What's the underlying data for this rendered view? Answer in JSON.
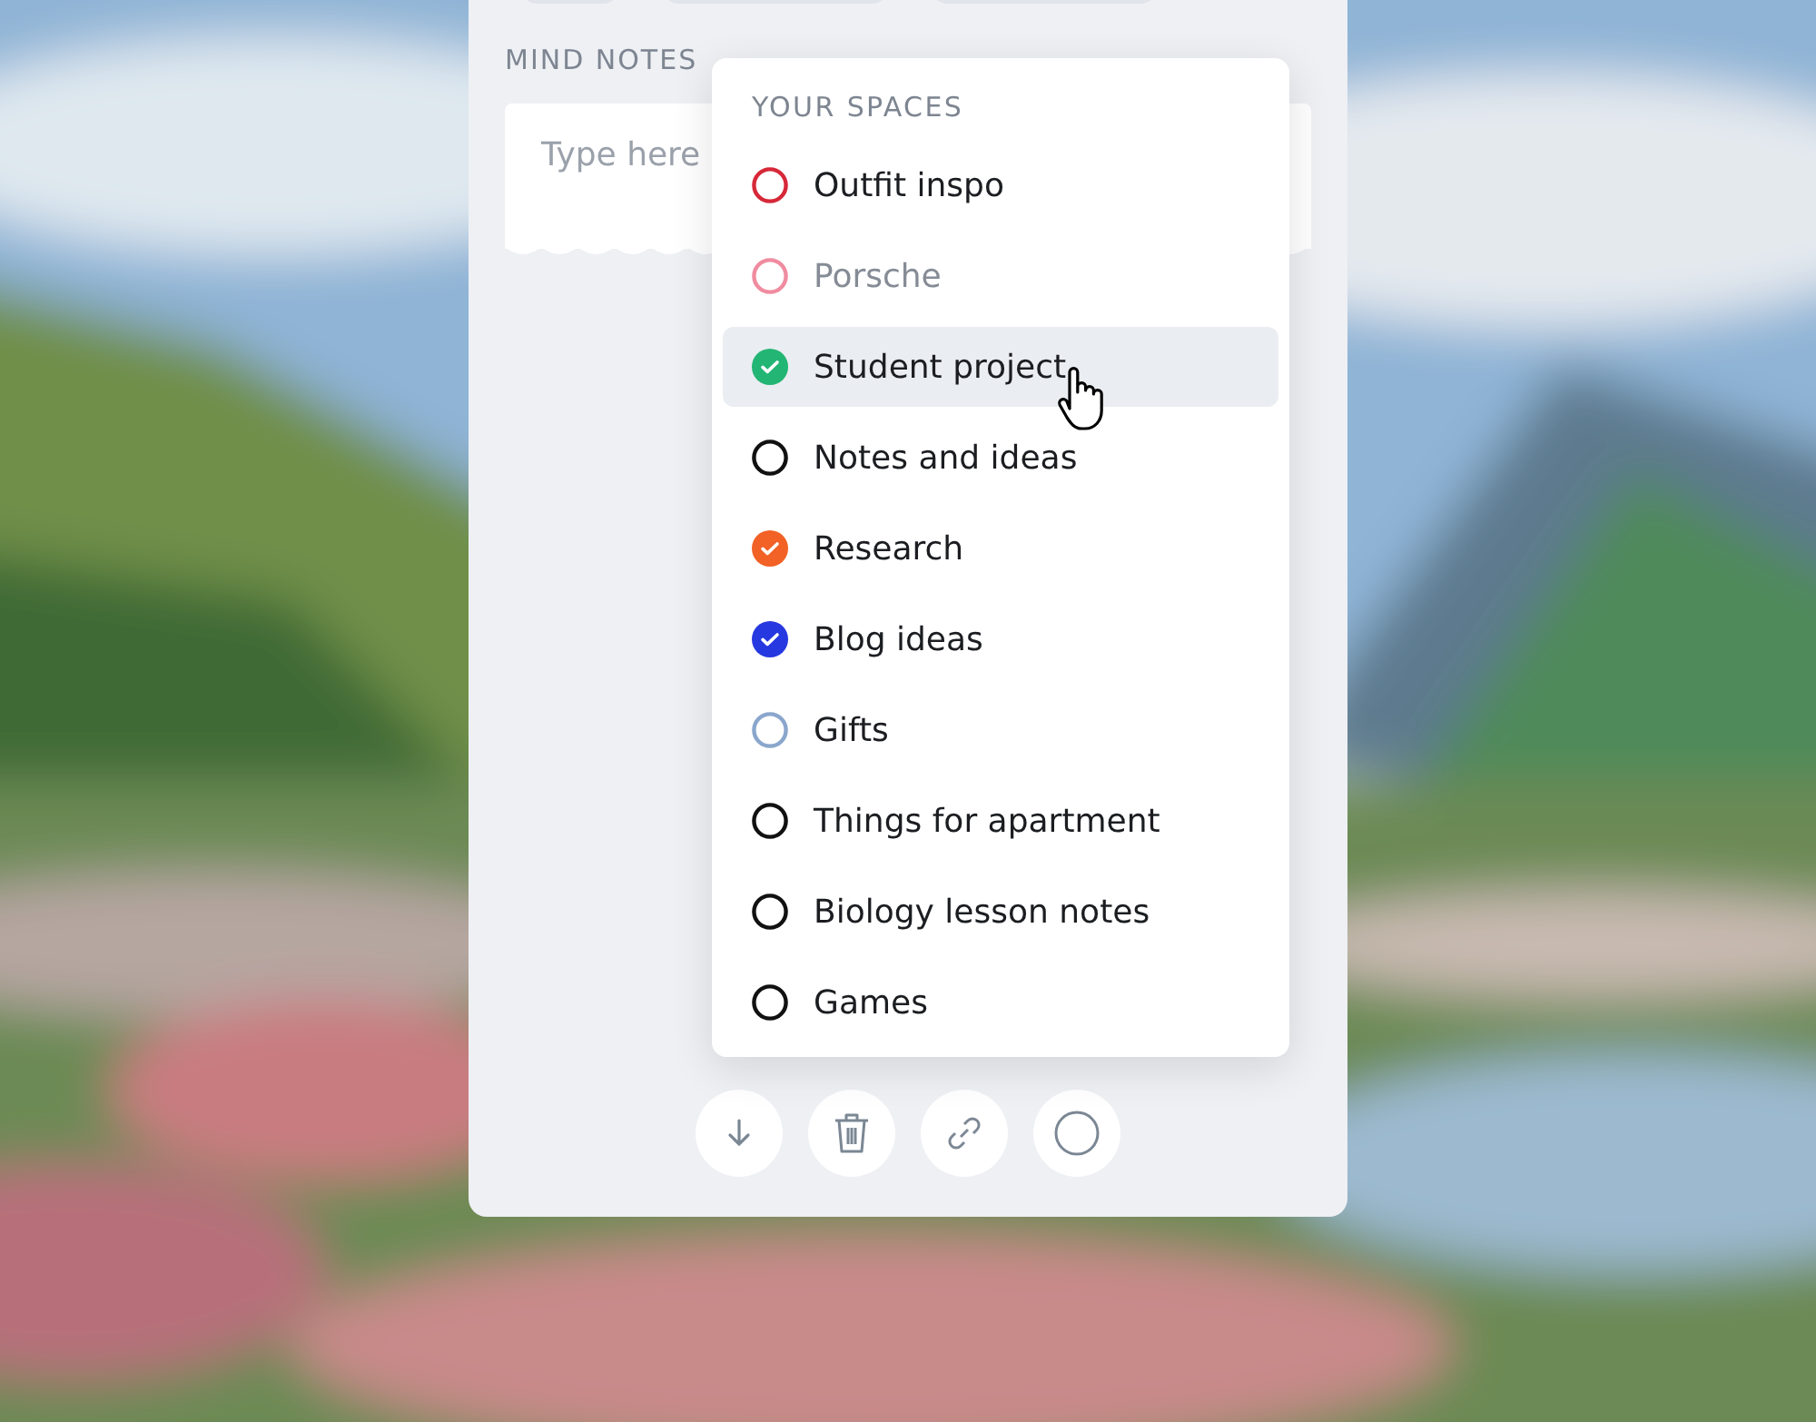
{
  "panel": {
    "top_pills": [
      {
        "kind": "pill"
      },
      {
        "kind": "pill"
      },
      {
        "kind": "pill"
      }
    ],
    "section_label": "MIND NOTES",
    "notes_field": {
      "placeholder": "Type here"
    },
    "actions": [
      {
        "kind": "download"
      },
      {
        "kind": "delete"
      },
      {
        "kind": "link"
      },
      {
        "kind": "circle"
      }
    ]
  },
  "spaces_menu": {
    "title": "YOUR SPACES",
    "items": [
      {
        "label": "Outfit inspo",
        "color": "#d62839",
        "checked": false,
        "disabled": false,
        "selected": false
      },
      {
        "label": "Porsche",
        "color": "#f08ca0",
        "checked": false,
        "disabled": true,
        "selected": false
      },
      {
        "label": "Student project",
        "color": "#22b573",
        "checked": true,
        "disabled": false,
        "selected": true
      },
      {
        "label": "Notes and ideas",
        "color": "#111111",
        "checked": false,
        "disabled": false,
        "selected": false
      },
      {
        "label": "Research",
        "color": "#f26125",
        "checked": true,
        "disabled": false,
        "selected": false
      },
      {
        "label": "Blog ideas",
        "color": "#2638e0",
        "checked": true,
        "disabled": false,
        "selected": false
      },
      {
        "label": "Gifts",
        "color": "#8aa6cc",
        "checked": false,
        "disabled": false,
        "selected": false
      },
      {
        "label": "Things for apartment",
        "color": "#111111",
        "checked": false,
        "disabled": false,
        "selected": false
      },
      {
        "label": "Biology lesson notes",
        "color": "#111111",
        "checked": false,
        "disabled": false,
        "selected": false
      },
      {
        "label": "Games",
        "color": "#111111",
        "checked": false,
        "disabled": false,
        "selected": false
      }
    ]
  }
}
